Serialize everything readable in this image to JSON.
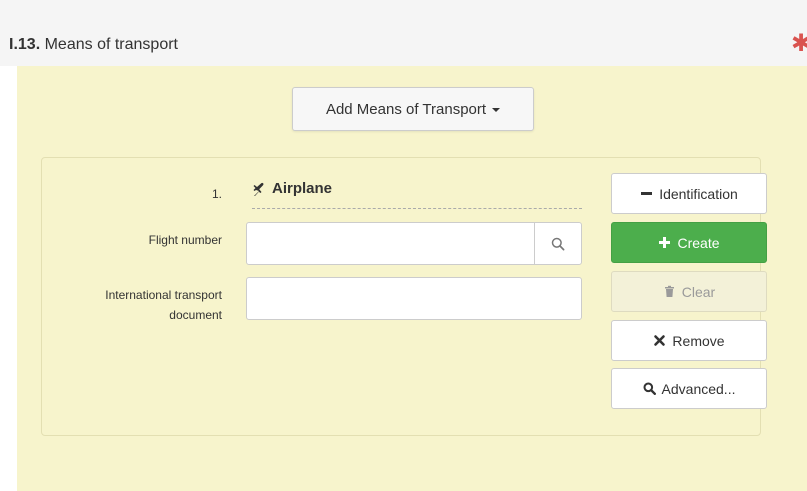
{
  "section": {
    "number": "I.13.",
    "title": "Means of transport",
    "required_mark": "✱"
  },
  "add_button": {
    "label": "Add Means of Transport"
  },
  "transport": {
    "index": "1.",
    "type": "Airplane",
    "icon": "airplane-icon"
  },
  "fields": {
    "flight_number": {
      "label": "Flight number",
      "value": "",
      "placeholder": ""
    },
    "international_transport_document": {
      "label_line1": "International transport",
      "label_line2": "document",
      "value": "",
      "placeholder": ""
    }
  },
  "buttons": {
    "identification": "Identification",
    "create": "Create",
    "clear": "Clear",
    "remove": "Remove",
    "advanced": "Advanced..."
  },
  "colors": {
    "panel_bg": "#f7f4cc",
    "create_green": "#4cae4c",
    "required_red": "#d9534f"
  }
}
